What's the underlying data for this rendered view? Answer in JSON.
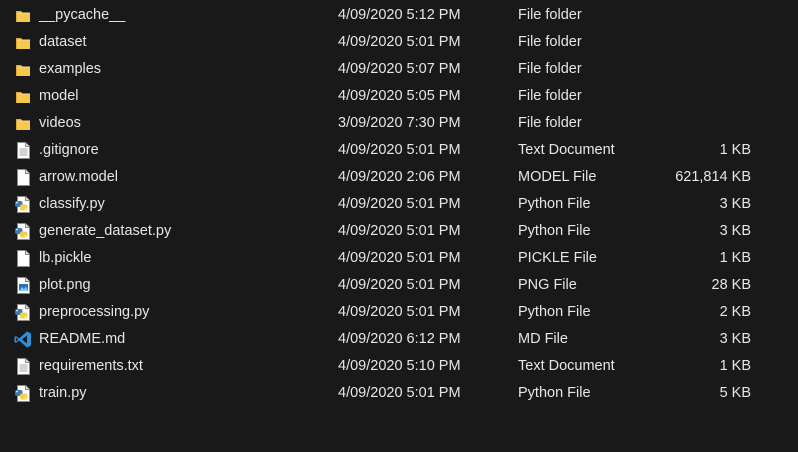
{
  "files": [
    {
      "name": "__pycache__",
      "date": "4/09/2020 5:12 PM",
      "type": "File folder",
      "size": "",
      "icon": "folder-icon"
    },
    {
      "name": "dataset",
      "date": "4/09/2020 5:01 PM",
      "type": "File folder",
      "size": "",
      "icon": "folder-icon"
    },
    {
      "name": "examples",
      "date": "4/09/2020 5:07 PM",
      "type": "File folder",
      "size": "",
      "icon": "folder-icon"
    },
    {
      "name": "model",
      "date": "4/09/2020 5:05 PM",
      "type": "File folder",
      "size": "",
      "icon": "folder-icon"
    },
    {
      "name": "videos",
      "date": "3/09/2020 7:30 PM",
      "type": "File folder",
      "size": "",
      "icon": "folder-icon"
    },
    {
      "name": ".gitignore",
      "date": "4/09/2020 5:01 PM",
      "type": "Text Document",
      "size": "1 KB",
      "icon": "text-document-icon"
    },
    {
      "name": "arrow.model",
      "date": "4/09/2020 2:06 PM",
      "type": "MODEL File",
      "size": "621,814 KB",
      "icon": "blank-file-icon"
    },
    {
      "name": "classify.py",
      "date": "4/09/2020 5:01 PM",
      "type": "Python File",
      "size": "3 KB",
      "icon": "python-file-icon"
    },
    {
      "name": "generate_dataset.py",
      "date": "4/09/2020 5:01 PM",
      "type": "Python File",
      "size": "3 KB",
      "icon": "python-file-icon"
    },
    {
      "name": "lb.pickle",
      "date": "4/09/2020 5:01 PM",
      "type": "PICKLE File",
      "size": "1 KB",
      "icon": "blank-file-icon"
    },
    {
      "name": "plot.png",
      "date": "4/09/2020 5:01 PM",
      "type": "PNG File",
      "size": "28 KB",
      "icon": "image-file-icon"
    },
    {
      "name": "preprocessing.py",
      "date": "4/09/2020 5:01 PM",
      "type": "Python File",
      "size": "2 KB",
      "icon": "python-file-icon"
    },
    {
      "name": "README.md",
      "date": "4/09/2020 6:12 PM",
      "type": "MD File",
      "size": "3 KB",
      "icon": "vscode-icon"
    },
    {
      "name": "requirements.txt",
      "date": "4/09/2020 5:10 PM",
      "type": "Text Document",
      "size": "1 KB",
      "icon": "text-document-icon"
    },
    {
      "name": "train.py",
      "date": "4/09/2020 5:01 PM",
      "type": "Python File",
      "size": "5 KB",
      "icon": "python-file-icon"
    }
  ],
  "colors": {
    "background": "#191919",
    "text": "#e6e6e6",
    "folder": "#f6c94e",
    "vscode": "#2f8fd8",
    "python_blue": "#3b78b5",
    "python_yellow": "#f3d04c"
  }
}
